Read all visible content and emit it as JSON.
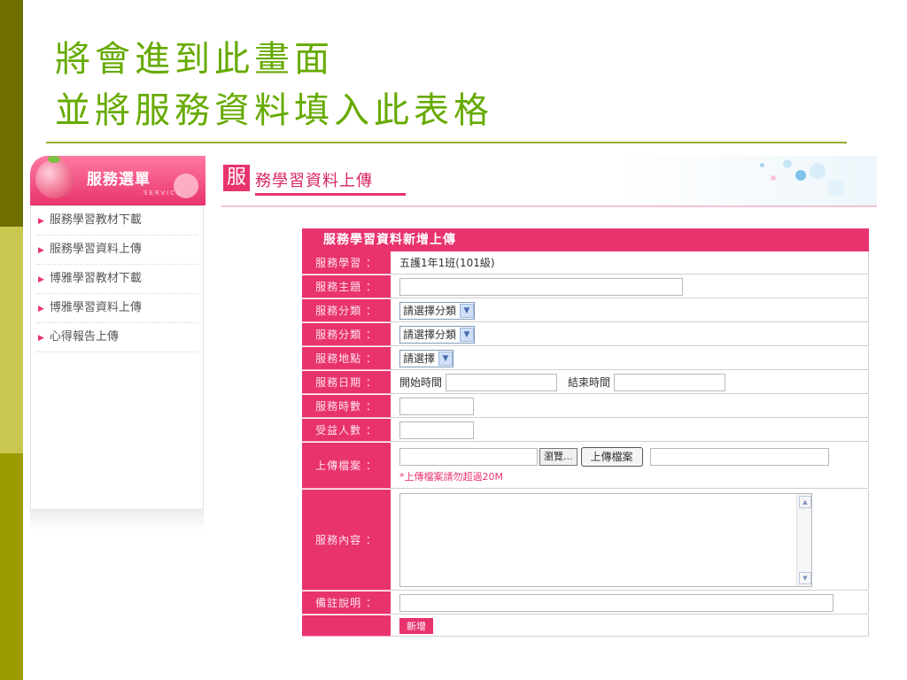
{
  "slide": {
    "title_line1": "將會進到此畫面",
    "title_line2": "並將服務資料填入此表格"
  },
  "sidebar": {
    "header_title": "服務選單",
    "header_sub": "SERVICE",
    "items": [
      {
        "label": "服務學習教材下載"
      },
      {
        "label": "服務學習資料上傳"
      },
      {
        "label": "博雅學習教材下載"
      },
      {
        "label": "博雅學習資料上傳"
      },
      {
        "label": "心得報告上傳"
      }
    ]
  },
  "banner": {
    "big_char": "服",
    "title": "務學習資料上傳"
  },
  "form": {
    "heading": "服務學習資料新增上傳",
    "labels": {
      "class": "服務學習 ：",
      "topic": "服務主題 ：",
      "category1": "服務分類 ：",
      "category2": "服務分類 ：",
      "location": "服務地點 ：",
      "date": "服務日期 ：",
      "hours": "服務時數 ：",
      "beneficiaries": "受益人數 ：",
      "upload": "上傳檔案 ：",
      "content": "服務內容 ：",
      "notes": "備註說明 ："
    },
    "class_value": "五護1年1班(101級)",
    "category1_value": "請選擇分類",
    "category2_value": "請選擇分類",
    "location_value": "請選擇",
    "start_label": "開始時間",
    "end_label": "結束時間",
    "browse_label": "瀏覽...",
    "upload_button": "上傳檔案",
    "upload_warning": "*上傳檔案請勿超過20M",
    "add_button": "新增"
  },
  "colors": {
    "accent": "#e8336d",
    "title_green": "#66aa00"
  }
}
